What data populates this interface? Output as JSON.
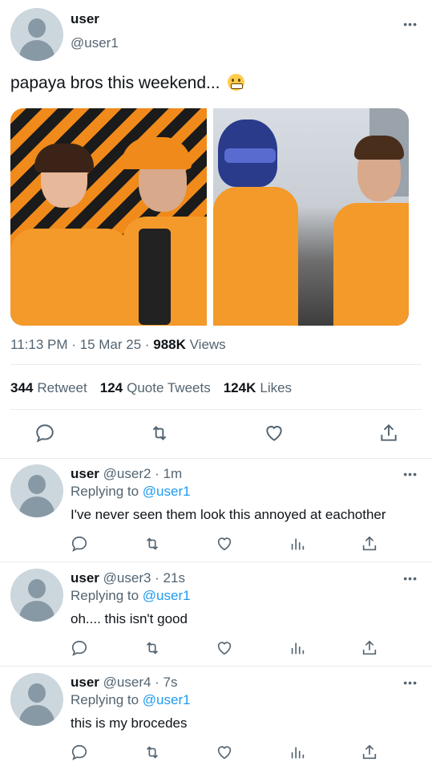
{
  "tweet": {
    "name": "user",
    "handle": "@user1",
    "text": "papaya bros this weekend... ",
    "emoji_icon": "grimacing-face-icon",
    "time": "11:13 PM · 15 Mar 25 · ",
    "views_count": "988K",
    "views_label": "Views",
    "retweets_count": "344",
    "retweets_label": "Retweet",
    "quotes_count": "124",
    "quotes_label": "Quote Tweets",
    "likes_count": "124K",
    "likes_label": "Likes"
  },
  "replies": [
    {
      "name": "user",
      "meta": "@user2 · 1m",
      "replying_prefix": "Replying to ",
      "replying_to": "@user1",
      "text": "I've never seen them look this annoyed at eachother"
    },
    {
      "name": "user",
      "meta": "@user3 · 21s",
      "replying_prefix": "Replying to ",
      "replying_to": "@user1",
      "text": "oh.... this isn't good"
    },
    {
      "name": "user",
      "meta": "@user4 · 7s",
      "replying_prefix": "Replying to ",
      "replying_to": "@user1",
      "text": "this is my brocedes"
    }
  ],
  "more_glyph": "•••",
  "colors": {
    "accent": "#1d9bf0",
    "muted": "#536471",
    "text": "#0f1419"
  }
}
